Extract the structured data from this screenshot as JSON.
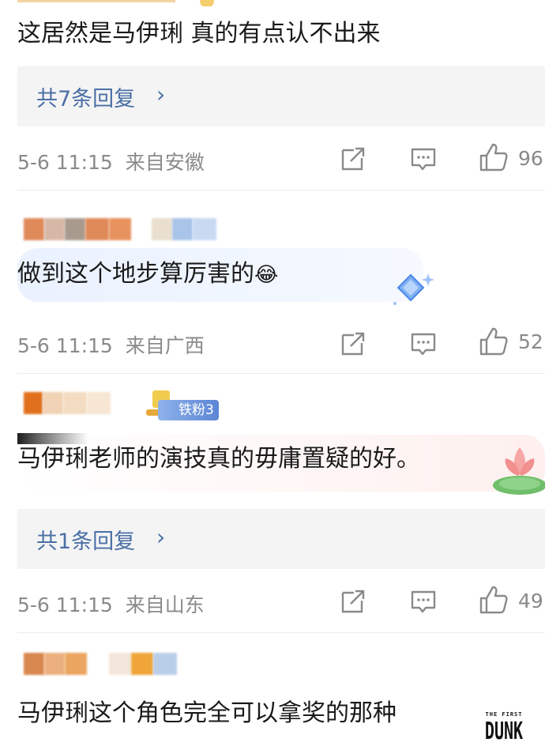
{
  "comments": [
    {
      "text": "这居然是马伊琍 真的有点认不出来",
      "reply_label": "共7条回复",
      "time": "5-6 11:15",
      "location": "来自安徽",
      "likes": "96"
    },
    {
      "text": "做到这个地步算厉害的",
      "emoji": "😂",
      "time": "5-6 11:15",
      "location": "来自广西",
      "likes": "52"
    },
    {
      "badge": "铁粉3",
      "text": "马伊琍老师的演技真的毋庸置疑的好。",
      "reply_label": "共1条回复",
      "time": "5-6 11:15",
      "location": "来自山东",
      "likes": "49"
    },
    {
      "text": "马伊琍这个角色完全可以拿奖的那种"
    }
  ],
  "ui": {
    "chevron": "›",
    "icons": [
      "share-icon",
      "comment-icon",
      "like-icon"
    ],
    "accent_link": "#4a6fa5",
    "meta_color": "#8a8a8a",
    "reply_bg": "#f4f4f5"
  },
  "watermark": {
    "line1": "THE FIRST",
    "line2": "DUNK"
  }
}
